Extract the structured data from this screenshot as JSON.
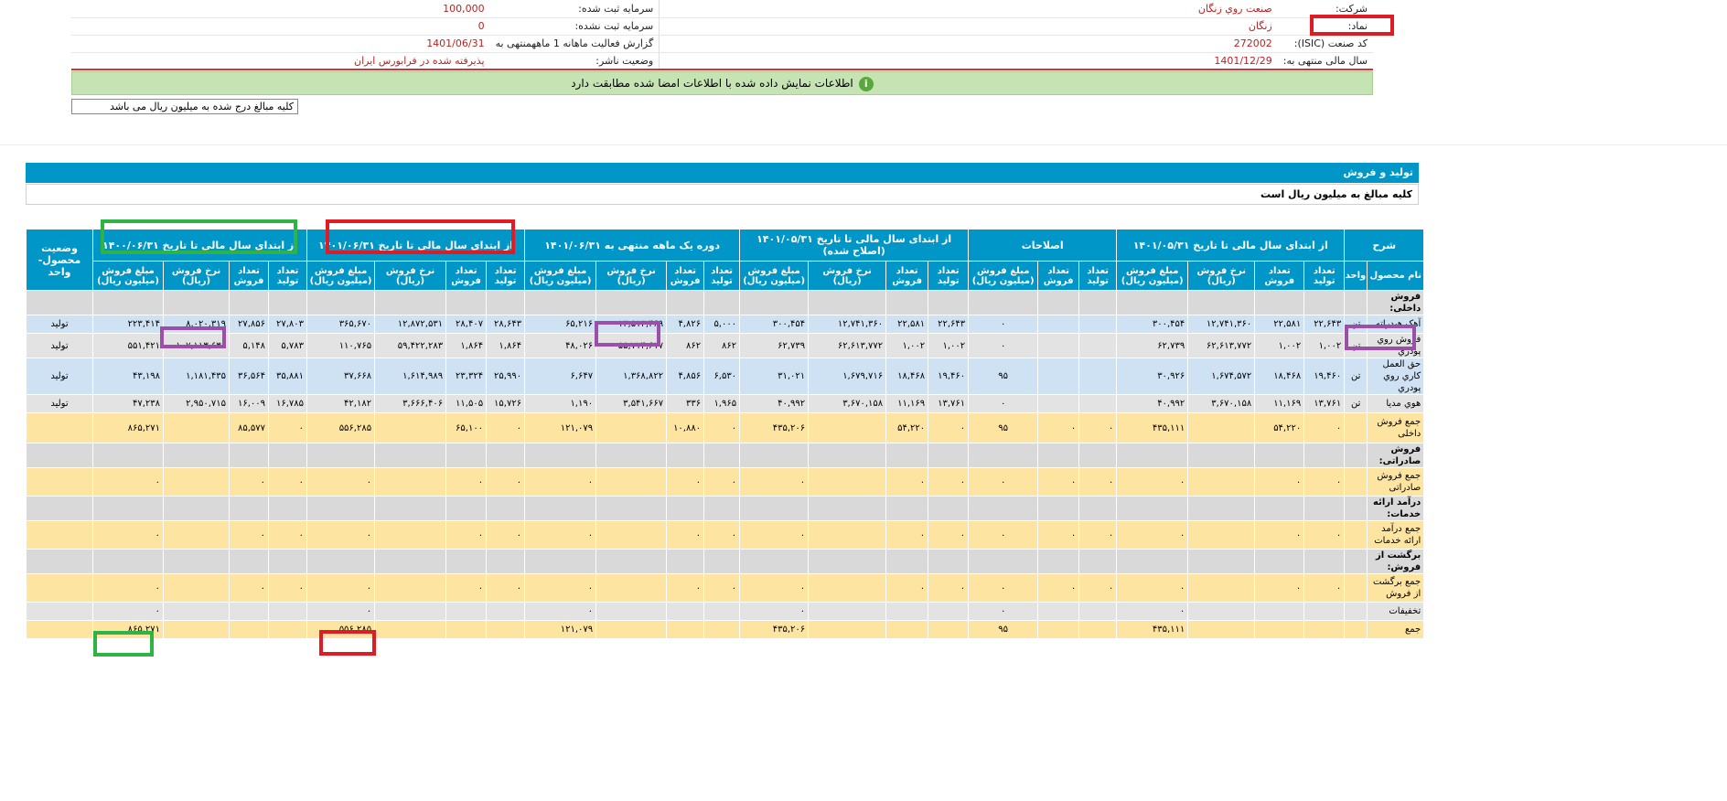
{
  "header": {
    "rows": [
      {
        "right_label": "شرکت:",
        "right_value": "صنعت روي زنگان",
        "left_label": "سرمایه ثبت شده:",
        "left_value": "100,000"
      },
      {
        "right_label": "نماد:",
        "right_value": "زنگان",
        "left_label": "سرمایه ثبت نشده:",
        "left_value": "0"
      },
      {
        "right_label": "کد صنعت (ISIC):",
        "right_value": "272002",
        "left_label": "گزارش فعالیت ماهانه 1 ماههمنتهی به",
        "left_value": "1401/06/31"
      },
      {
        "right_label": "سال مالی منتهی به:",
        "right_value": "1401/12/29",
        "left_label": "وضعیت ناشر:",
        "left_value": "پذیرفته شده در فرابورس ایران"
      }
    ],
    "notice": "اطلاعات نمایش داده شده با اطلاعات امضا شده مطابقت دارد",
    "notice_icon": "info-icon",
    "unit_note": "کلیه مبالغ درج شده به میلیون ریال می باشد"
  },
  "section": {
    "title": "تولید و فروش",
    "note": "کلیه مبالغ به میلیون ریال است"
  },
  "table": {
    "group_headers": {
      "desc": "شرح",
      "g1": "از ابتدای سال مالی تا تاریخ ۱۴۰۱/۰۵/۳۱",
      "g2": "اصلاحات",
      "g3": "از ابتدای سال مالی تا تاریخ ۱۴۰۱/۰۵/۳۱ (اصلاح شده)",
      "g4": "دوره یک ماهه منتهی به ۱۴۰۱/۰۶/۳۱",
      "g5": "از ابتدای سال مالی تا تاریخ ۱۴۰۱/۰۶/۳۱",
      "g6": "از ابتدای سال مالی تا تاریخ ۱۴۰۰/۰۶/۳۱",
      "status": "وضعیت محصول-واحد"
    },
    "sub_headers": {
      "name": "نام محصول",
      "unit": "واحد",
      "prod": "تعداد تولید",
      "sale": "تعداد فروش",
      "rate": "نرخ فروش (ریال)",
      "amount": "مبلغ فروش (میلیون ریال)"
    },
    "rows": [
      {
        "type": "cat",
        "style": "gray",
        "name": "فروش داخلی:"
      },
      {
        "type": "data",
        "style": "blue",
        "name": "آهک هیدراته",
        "unit": "تن",
        "g1": [
          "۲۲,۶۴۳",
          "۲۲,۵۸۱",
          "۱۲,۷۴۱,۳۶۰",
          "۳۰۰,۴۵۴"
        ],
        "g2": [
          "",
          "",
          "۰"
        ],
        "g3": [
          "۲۲,۶۴۳",
          "۲۲,۵۸۱",
          "۱۲,۷۴۱,۳۶۰",
          "۳۰۰,۴۵۴"
        ],
        "g4": [
          "۵,۰۰۰",
          "۴,۸۲۶",
          "۱۳,۵۱۳,۴۶۹",
          "۶۵,۲۱۶"
        ],
        "g5": [
          "۲۸,۶۴۳",
          "۲۸,۴۰۷",
          "۱۲,۸۷۲,۵۳۱",
          "۳۶۵,۶۷۰"
        ],
        "g6": [
          "۲۷,۸۰۳",
          "۲۷,۸۵۶",
          "۸,۰۲۰,۳۱۹",
          "۲۲۳,۴۱۴"
        ],
        "status": "تولید"
      },
      {
        "type": "data",
        "style": "light",
        "name": "فروش روي پودري",
        "unit": "تن",
        "g1": [
          "۱,۰۰۲",
          "۱,۰۰۲",
          "۶۲,۶۱۳,۷۷۲",
          "۶۲,۷۳۹"
        ],
        "g2": [
          "",
          "",
          "۰"
        ],
        "g3": [
          "۱,۰۰۲",
          "۱,۰۰۲",
          "۶۲,۶۱۳,۷۷۲",
          "۶۲,۷۳۹"
        ],
        "g4": [
          "۸۶۲",
          "۸۶۲",
          "۵۵,۷۱۴,۶۱۷",
          "۴۸,۰۲۶"
        ],
        "g5": [
          "۱,۸۶۴",
          "۱,۸۶۴",
          "۵۹,۴۲۲,۲۸۳",
          "۱۱۰,۷۶۵"
        ],
        "g6": [
          "۵,۷۸۳",
          "۵,۱۴۸",
          "۱۰۷,۱۱۳,۶۳۶",
          "۵۵۱,۴۲۱"
        ],
        "status": "تولید"
      },
      {
        "type": "data",
        "style": "blue",
        "name": "حق العمل کاري روي پودري",
        "unit": "تن",
        "g1": [
          "۱۹,۴۶۰",
          "۱۸,۴۶۸",
          "۱,۶۷۴,۵۷۲",
          "۳۰,۹۲۶"
        ],
        "g2": [
          "",
          "",
          "۹۵"
        ],
        "g3": [
          "۱۹,۴۶۰",
          "۱۸,۴۶۸",
          "۱,۶۷۹,۷۱۶",
          "۳۱,۰۲۱"
        ],
        "g4": [
          "۶,۵۳۰",
          "۴,۸۵۶",
          "۱,۳۶۸,۸۲۲",
          "۶,۶۴۷"
        ],
        "g5": [
          "۲۵,۹۹۰",
          "۲۳,۳۲۴",
          "۱,۶۱۴,۹۸۹",
          "۳۷,۶۶۸"
        ],
        "g6": [
          "۳۵,۸۸۱",
          "۳۶,۵۶۴",
          "۱,۱۸۱,۴۳۵",
          "۴۳,۱۹۸"
        ],
        "status": "تولید"
      },
      {
        "type": "data",
        "style": "light",
        "name": "هوي مديا",
        "unit": "تن",
        "g1": [
          "۱۳,۷۶۱",
          "۱۱,۱۶۹",
          "۳,۶۷۰,۱۵۸",
          "۴۰,۹۹۲"
        ],
        "g2": [
          "",
          "",
          "۰"
        ],
        "g3": [
          "۱۳,۷۶۱",
          "۱۱,۱۶۹",
          "۳,۶۷۰,۱۵۸",
          "۴۰,۹۹۲"
        ],
        "g4": [
          "۱,۹۶۵",
          "۳۳۶",
          "۳,۵۴۱,۶۶۷",
          "۱,۱۹۰"
        ],
        "g5": [
          "۱۵,۷۲۶",
          "۱۱,۵۰۵",
          "۳,۶۶۶,۴۰۶",
          "۴۲,۱۸۲"
        ],
        "g6": [
          "۱۶,۷۸۵",
          "۱۶,۰۰۹",
          "۲,۹۵۰,۷۱۵",
          "۴۷,۲۳۸"
        ],
        "status": "تولید"
      },
      {
        "type": "sum",
        "style": "yellow",
        "name": "جمع فروش داخلی",
        "unit": "",
        "g1": [
          "۰",
          "۵۴,۲۲۰",
          "",
          "۴۳۵,۱۱۱"
        ],
        "g2": [
          "۰",
          "۰",
          "۹۵"
        ],
        "g3": [
          "۰",
          "۵۴,۲۲۰",
          "",
          "۴۳۵,۲۰۶"
        ],
        "g4": [
          "۰",
          "۱۰,۸۸۰",
          "",
          "۱۲۱,۰۷۹"
        ],
        "g5": [
          "۰",
          "۶۵,۱۰۰",
          "",
          "۵۵۶,۲۸۵"
        ],
        "g6": [
          "۰",
          "۸۵,۵۷۷",
          "",
          "۸۶۵,۲۷۱"
        ],
        "status": ""
      },
      {
        "type": "cat",
        "style": "gray",
        "name": "فروش صادراتی:"
      },
      {
        "type": "sum",
        "style": "yellow",
        "name": "جمع فروش صادراتی",
        "unit": "",
        "g1": [
          "۰",
          "۰",
          "",
          "۰"
        ],
        "g2": [
          "۰",
          "۰",
          "۰"
        ],
        "g3": [
          "۰",
          "۰",
          "",
          "۰"
        ],
        "g4": [
          "۰",
          "۰",
          "",
          "۰"
        ],
        "g5": [
          "۰",
          "۰",
          "",
          "۰"
        ],
        "g6": [
          "۰",
          "۰",
          "",
          "۰"
        ],
        "status": ""
      },
      {
        "type": "cat",
        "style": "gray",
        "name": "درآمد ارائه خدمات:"
      },
      {
        "type": "sum",
        "style": "yellow",
        "name": "جمع درآمد ارائه خدمات",
        "unit": "",
        "g1": [
          "۰",
          "۰",
          "",
          "۰"
        ],
        "g2": [
          "۰",
          "۰",
          "۰"
        ],
        "g3": [
          "۰",
          "۰",
          "",
          "۰"
        ],
        "g4": [
          "۰",
          "۰",
          "",
          "۰"
        ],
        "g5": [
          "۰",
          "۰",
          "",
          "۰"
        ],
        "g6": [
          "۰",
          "۰",
          "",
          "۰"
        ],
        "status": ""
      },
      {
        "type": "cat",
        "style": "gray",
        "name": "برگشت از فروش:"
      },
      {
        "type": "sum",
        "style": "yellow",
        "name": "جمع برگشت از فروش",
        "unit": "",
        "g1": [
          "۰",
          "۰",
          "",
          "۰"
        ],
        "g2": [
          "۰",
          "۰",
          "۰"
        ],
        "g3": [
          "۰",
          "۰",
          "",
          "۰"
        ],
        "g4": [
          "۰",
          "۰",
          "",
          "۰"
        ],
        "g5": [
          "۰",
          "۰",
          "",
          "۰"
        ],
        "g6": [
          "۰",
          "۰",
          "",
          "۰"
        ],
        "status": ""
      },
      {
        "type": "sum",
        "style": "light",
        "name": "تخفیفات",
        "unit": "",
        "g1": [
          "",
          "",
          "",
          "۰"
        ],
        "g2": [
          "",
          "",
          "۰"
        ],
        "g3": [
          "",
          "",
          "",
          "۰"
        ],
        "g4": [
          "",
          "",
          "",
          "۰"
        ],
        "g5": [
          "",
          "",
          "",
          "۰"
        ],
        "g6": [
          "",
          "",
          "",
          "۰"
        ],
        "status": ""
      },
      {
        "type": "sum",
        "style": "yellow",
        "name": "جمع",
        "unit": "",
        "g1": [
          "",
          "",
          "",
          "۴۳۵,۱۱۱"
        ],
        "g2": [
          "",
          "",
          "۹۵"
        ],
        "g3": [
          "",
          "",
          "",
          "۴۳۵,۲۰۶"
        ],
        "g4": [
          "",
          "",
          "",
          "۱۲۱,۰۷۹"
        ],
        "g5": [
          "",
          "",
          "",
          "۵۵۶,۲۸۵"
        ],
        "g6": [
          "",
          "",
          "",
          "۸۶۵,۲۷۱"
        ],
        "status": ""
      }
    ]
  },
  "colors": {
    "header_blue": "#0096c8",
    "highlight_red": "#e01b24",
    "highlight_green": "#2fb344",
    "highlight_purple": "#9b4fa8"
  }
}
